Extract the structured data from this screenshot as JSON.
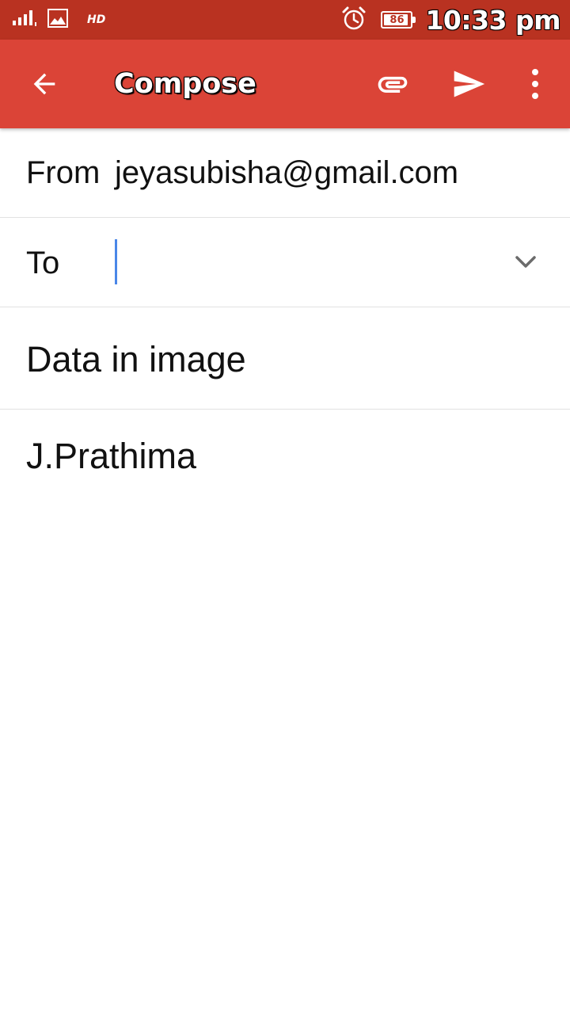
{
  "status_bar": {
    "signal_icon": "signal-bars-icon",
    "gallery_icon": "image-icon",
    "network_label": "HD",
    "alarm_icon": "alarm-clock-icon",
    "battery_level": "86",
    "time": "10:33 pm"
  },
  "app_bar": {
    "back_icon": "arrow-back-icon",
    "title": "Compose",
    "attach_icon": "paperclip-icon",
    "send_icon": "send-icon",
    "more_icon": "more-vert-icon",
    "background_color": "#db4437",
    "status_color": "#b93221"
  },
  "compose": {
    "from_label": "From",
    "from_value": "jeyasubisha@gmail.com",
    "to_label": "To",
    "to_value": "",
    "to_expand_icon": "chevron-down-icon",
    "subject": "Data in image",
    "body": "J.Prathima"
  }
}
